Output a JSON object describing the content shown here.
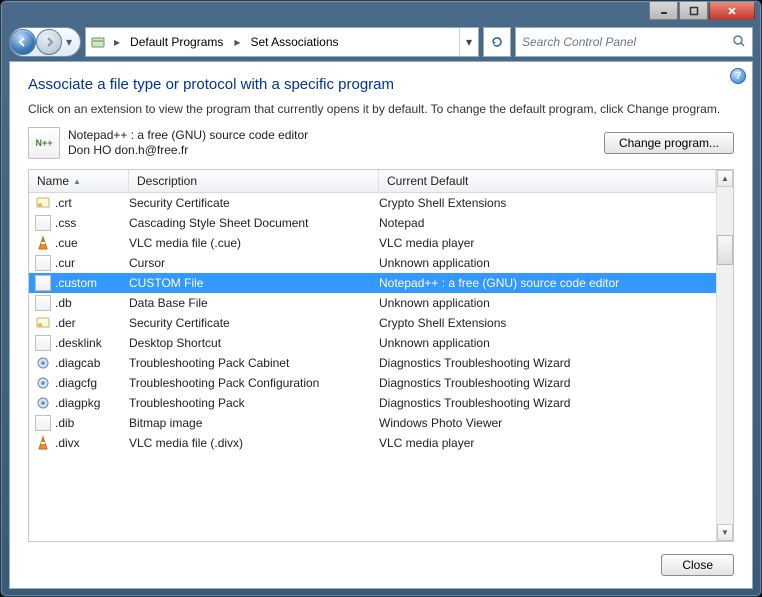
{
  "breadcrumb": {
    "items": [
      "Default Programs",
      "Set Associations"
    ]
  },
  "search": {
    "placeholder": "Search Control Panel"
  },
  "heading": "Associate a file type or protocol with a specific program",
  "description": "Click on an extension to view the program that currently opens it by default. To change the default program, click Change program.",
  "selected_program": {
    "line1": "Notepad++ : a free (GNU) source code editor",
    "line2": "Don HO don.h@free.fr"
  },
  "buttons": {
    "change_program": "Change program...",
    "close": "Close"
  },
  "columns": {
    "name": "Name",
    "description": "Description",
    "default": "Current Default"
  },
  "rows": [
    {
      "icon": "cert",
      "name": ".crt",
      "desc": "Security Certificate",
      "def": "Crypto Shell Extensions",
      "selected": false
    },
    {
      "icon": "page",
      "name": ".css",
      "desc": "Cascading Style Sheet Document",
      "def": "Notepad",
      "selected": false
    },
    {
      "icon": "vlc",
      "name": ".cue",
      "desc": "VLC media file (.cue)",
      "def": "VLC media player",
      "selected": false
    },
    {
      "icon": "page",
      "name": ".cur",
      "desc": "Cursor",
      "def": "Unknown application",
      "selected": false
    },
    {
      "icon": "page",
      "name": ".custom",
      "desc": "CUSTOM File",
      "def": "Notepad++ : a free (GNU) source code editor",
      "selected": true
    },
    {
      "icon": "page",
      "name": ".db",
      "desc": "Data Base File",
      "def": "Unknown application",
      "selected": false
    },
    {
      "icon": "cert",
      "name": ".der",
      "desc": "Security Certificate",
      "def": "Crypto Shell Extensions",
      "selected": false
    },
    {
      "icon": "page",
      "name": ".desklink",
      "desc": "Desktop Shortcut",
      "def": "Unknown application",
      "selected": false
    },
    {
      "icon": "gear",
      "name": ".diagcab",
      "desc": "Troubleshooting Pack Cabinet",
      "def": "Diagnostics Troubleshooting Wizard",
      "selected": false
    },
    {
      "icon": "gear",
      "name": ".diagcfg",
      "desc": "Troubleshooting Pack Configuration",
      "def": "Diagnostics Troubleshooting Wizard",
      "selected": false
    },
    {
      "icon": "gear",
      "name": ".diagpkg",
      "desc": "Troubleshooting Pack",
      "def": "Diagnostics Troubleshooting Wizard",
      "selected": false
    },
    {
      "icon": "page",
      "name": ".dib",
      "desc": "Bitmap image",
      "def": "Windows Photo Viewer",
      "selected": false
    },
    {
      "icon": "vlc",
      "name": ".divx",
      "desc": "VLC media file (.divx)",
      "def": "VLC media player",
      "selected": false
    }
  ]
}
